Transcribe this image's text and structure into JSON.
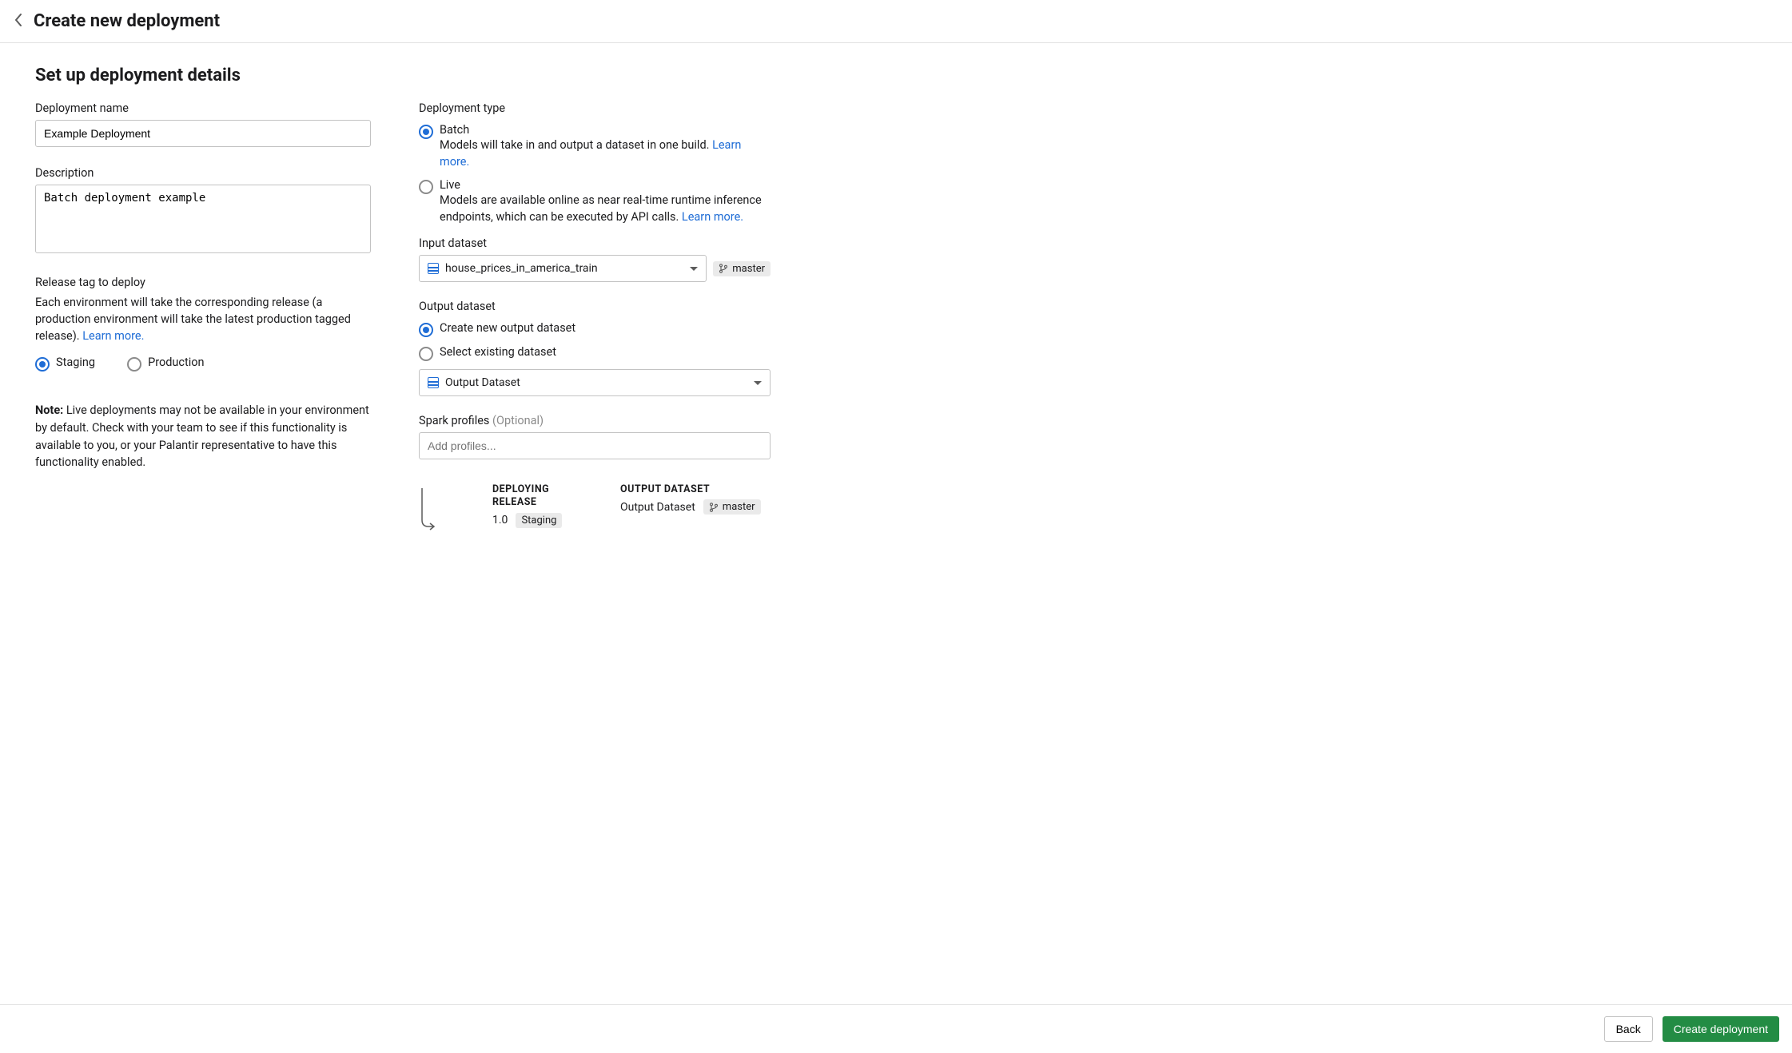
{
  "header": {
    "title": "Create new deployment"
  },
  "sectionTitle": "Set up deployment details",
  "left": {
    "nameLabel": "Deployment name",
    "nameValue": "Example Deployment",
    "descLabel": "Description",
    "descValue": "Batch deployment example",
    "releaseTagLabel": "Release tag to deploy",
    "releaseTagHelp": "Each environment will take the corresponding release (a production environment will take the latest production tagged release).",
    "learnMore": "Learn more.",
    "stagingLabel": "Staging",
    "productionLabel": "Production",
    "noteBold": "Note:",
    "noteText": " Live deployments may not be available in your environment by default. Check with your team to see if this functionality is available to you, or your Palantir representative to have this functionality enabled."
  },
  "right": {
    "deploymentTypeLabel": "Deployment type",
    "batchLabel": "Batch",
    "batchDesc": "Models will take in and output a dataset in one build.",
    "liveLabel": "Live",
    "liveDesc": "Models are available online as near real-time runtime inference endpoints, which can be executed by API calls.",
    "learnMore": "Learn more.",
    "inputDatasetLabel": "Input dataset",
    "inputDatasetValue": "house_prices_in_america_train",
    "inputBranch": "master",
    "outputDatasetLabel": "Output dataset",
    "createNewOutputLabel": "Create new output dataset",
    "selectExistingLabel": "Select existing dataset",
    "outputDatasetValue": "Output Dataset",
    "sparkLabel": "Spark profiles ",
    "sparkOptional": "(Optional)",
    "sparkPlaceholder": "Add profiles...",
    "summary": {
      "deployingReleaseLabel": "DEPLOYING RELEASE",
      "releaseVersion": "1.0",
      "releaseTag": "Staging",
      "outputDatasetLabel": "OUTPUT DATASET",
      "outputDatasetName": "Output Dataset",
      "outputBranch": "master"
    }
  },
  "footer": {
    "back": "Back",
    "create": "Create deployment"
  }
}
